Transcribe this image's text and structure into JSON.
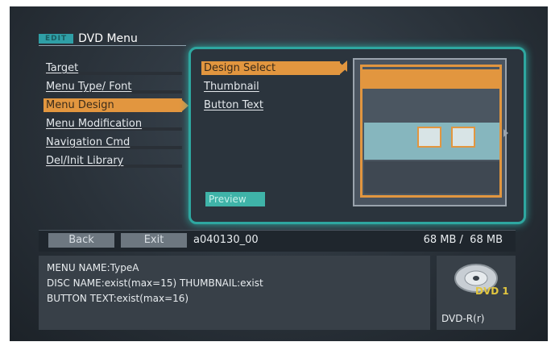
{
  "header": {
    "badge": "EDIT",
    "title": "DVD Menu"
  },
  "menu": {
    "items": [
      {
        "label": "Target"
      },
      {
        "label": "Menu Type/ Font"
      },
      {
        "label": "Menu Design"
      },
      {
        "label": "Menu Modification"
      },
      {
        "label": "Navigation Cmd"
      },
      {
        "label": "Del/Init Library"
      }
    ],
    "active_index": 2
  },
  "submenu": {
    "items": [
      {
        "label": "Design Select"
      },
      {
        "label": "Thumbnail"
      },
      {
        "label": "Button Text"
      }
    ],
    "active_index": 0,
    "preview_label": "Preview"
  },
  "bottom": {
    "back_label": "Back",
    "exit_label": "Exit",
    "filename": "a040130_00",
    "size_text": "68 MB /  68 MB"
  },
  "info": {
    "line1": "MENU NAME:TypeA",
    "line2": "DISC NAME:exist(max=15)  THUMBNAIL:exist",
    "line3": "BUTTON TEXT:exist(max=16)"
  },
  "disc": {
    "label": "DVD 1",
    "type": "DVD-R(r)"
  },
  "colors": {
    "accent": "#e2963f",
    "panel_glow": "#2ea7a0",
    "background": "#2a323a"
  },
  "icons": {
    "disc": "dvd-disc-icon"
  }
}
